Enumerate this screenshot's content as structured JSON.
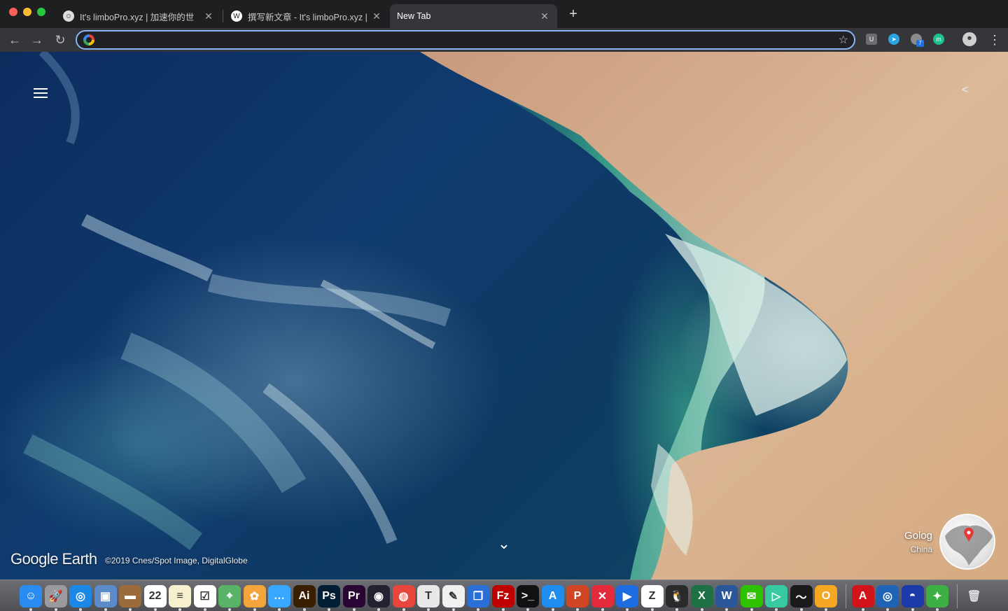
{
  "window": {
    "tabs": [
      {
        "title": "It's limboPro.xyz | 加速你的世",
        "active": false
      },
      {
        "title": "撰写新文章 - It's limboPro.xyz |",
        "active": false
      },
      {
        "title": "New Tab",
        "active": true
      }
    ],
    "new_tab_symbol": "+",
    "close_symbol": "✕"
  },
  "toolbar": {
    "back_icon": "←",
    "forward_icon": "→",
    "reload_icon": "↻",
    "address_value": "",
    "address_placeholder": "",
    "star_icon": "☆",
    "menu_icon": "⋮",
    "extension_badge": "7"
  },
  "earth": {
    "logo_text": "Google Earth",
    "credit": "©2019 Cnes/Spot Image, DigitalGlobe",
    "place_name": "Golog",
    "place_country": "China",
    "chevron": "⌄",
    "share_icon": "<",
    "colors": {
      "ocean": "#0e3a63",
      "coast": "#3aa88a",
      "desert": "#d8b08a"
    }
  },
  "dock": {
    "apps": [
      {
        "name": "finder",
        "label": "☺",
        "color": "#2a8cf0"
      },
      {
        "name": "launchpad",
        "label": "🚀",
        "color": "#9a9a9f"
      },
      {
        "name": "safari",
        "label": "◎",
        "color": "#1b87e6"
      },
      {
        "name": "preview",
        "label": "▣",
        "color": "#5b8bc9"
      },
      {
        "name": "notefile",
        "label": "▬",
        "color": "#9c6b3c"
      },
      {
        "name": "calendar",
        "label": "22",
        "color": "#ffffff"
      },
      {
        "name": "notes",
        "label": "≡",
        "color": "#f6f1cc"
      },
      {
        "name": "reminders",
        "label": "☑",
        "color": "#ffffff"
      },
      {
        "name": "maps",
        "label": "⌖",
        "color": "#58b368"
      },
      {
        "name": "photos",
        "label": "✿",
        "color": "#f3a43a"
      },
      {
        "name": "messages",
        "label": "…",
        "color": "#37a7ff"
      },
      {
        "name": "illustrator",
        "label": "Ai",
        "color": "#3a1e00"
      },
      {
        "name": "photoshop",
        "label": "Ps",
        "color": "#001d34"
      },
      {
        "name": "premiere",
        "label": "Pr",
        "color": "#2a0634"
      },
      {
        "name": "camera",
        "label": "◉",
        "color": "#222233"
      },
      {
        "name": "chrome",
        "label": "◍",
        "color": "#e9463b"
      },
      {
        "name": "typora",
        "label": "T",
        "color": "#e8e8e8"
      },
      {
        "name": "textedit",
        "label": "✎",
        "color": "#f0f0f0"
      },
      {
        "name": "screens",
        "label": "❐",
        "color": "#2b6fd6"
      },
      {
        "name": "filezilla",
        "label": "Fz",
        "color": "#bf0000"
      },
      {
        "name": "terminal",
        "label": ">_",
        "color": "#111111"
      },
      {
        "name": "appstore",
        "label": "A",
        "color": "#1f8df0"
      },
      {
        "name": "powerpoint",
        "label": "P",
        "color": "#d04523"
      },
      {
        "name": "xmind",
        "label": "✕",
        "color": "#e52b3b"
      },
      {
        "name": "infuse",
        "label": "▶",
        "color": "#1d6de0"
      },
      {
        "name": "zotero",
        "label": "Z",
        "color": "#ffffff"
      },
      {
        "name": "qq",
        "label": "🐧",
        "color": "#2a2a2a"
      },
      {
        "name": "excel",
        "label": "X",
        "color": "#1e7145"
      },
      {
        "name": "word",
        "label": "W",
        "color": "#2b579a"
      },
      {
        "name": "wechat",
        "label": "✉",
        "color": "#2dc100"
      },
      {
        "name": "iina",
        "label": "▷",
        "color": "#37c9a0"
      },
      {
        "name": "activity",
        "label": "〜",
        "color": "#1a1a1a"
      },
      {
        "name": "vpn",
        "label": "O",
        "color": "#f5a623"
      }
    ],
    "right_apps": [
      {
        "name": "acrobat",
        "label": "A",
        "color": "#d0141a"
      },
      {
        "name": "proxy",
        "label": "◎",
        "color": "#1e63b5"
      },
      {
        "name": "thermo",
        "label": "◓",
        "color": "#1c3aa9"
      },
      {
        "name": "music",
        "label": "✦",
        "color": "#3cb043"
      }
    ],
    "trash_label": "🗑"
  }
}
